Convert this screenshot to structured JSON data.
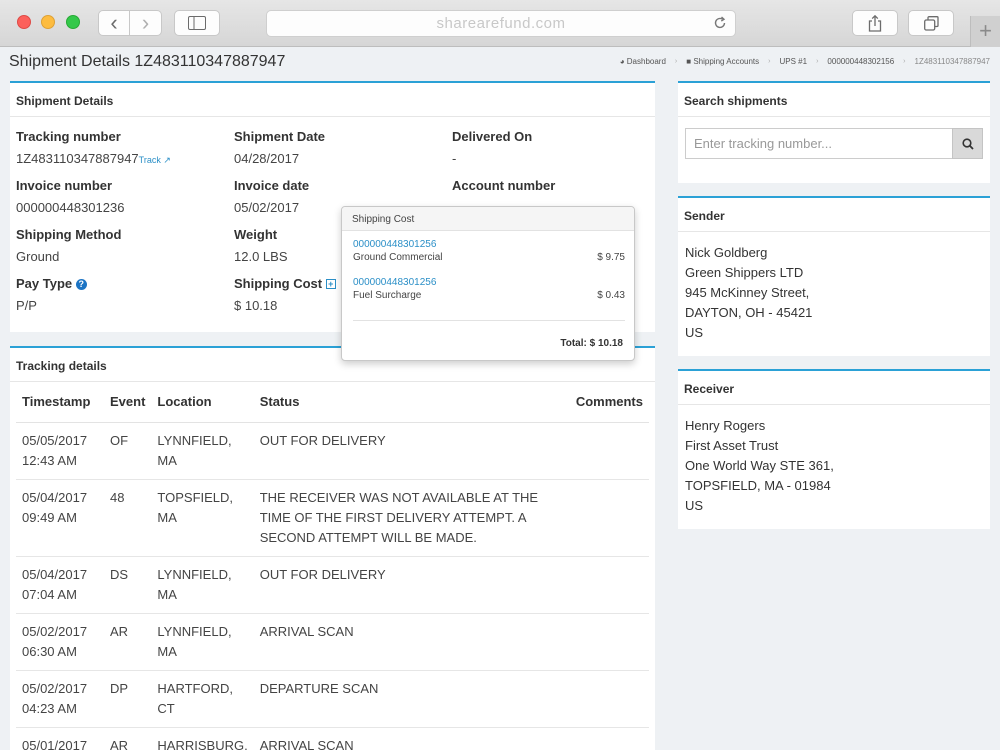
{
  "browser": {
    "url": "sharearefund.com",
    "back_icon": "‹",
    "forward_icon": "›",
    "plus_tab": "+"
  },
  "page": {
    "title": "Shipment Details 1Z483110347887947",
    "breadcrumb": [
      "Dashboard",
      "Shipping Accounts",
      "UPS #1",
      "000000448302156",
      "1Z483110347887947"
    ]
  },
  "shipment": {
    "heading": "Shipment Details",
    "tracking_number_label": "Tracking number",
    "tracking_number": "1Z483110347887947",
    "track_link": "Track",
    "shipment_date_label": "Shipment Date",
    "shipment_date": "04/28/2017",
    "delivered_on_label": "Delivered On",
    "delivered_on": "-",
    "invoice_number_label": "Invoice number",
    "invoice_number": "000000448301236",
    "invoice_date_label": "Invoice date",
    "invoice_date": "05/02/2017",
    "account_number_label": "Account number",
    "shipping_method_label": "Shipping Method",
    "shipping_method": "Ground",
    "weight_label": "Weight",
    "weight": "12.0 LBS",
    "pay_type_label": "Pay Type",
    "pay_type": "P/P",
    "shipping_cost_label": "Shipping Cost",
    "shipping_cost": "$ 10.18"
  },
  "popover": {
    "title": "Shipping Cost",
    "items": [
      {
        "id": "000000448301256",
        "desc": "Ground Commercial",
        "amount": "$ 9.75"
      },
      {
        "id": "000000448301256",
        "desc": "Fuel Surcharge",
        "amount": "$ 0.43"
      }
    ],
    "total": "Total: $ 10.18"
  },
  "tracking": {
    "heading": "Tracking details",
    "columns": [
      "Timestamp",
      "Event",
      "Location",
      "Status",
      "Comments"
    ],
    "rows": [
      {
        "ts1": "05/05/2017",
        "ts2": "12:43 AM",
        "event": "OF",
        "loc1": "LYNNFIELD,",
        "loc2": "MA",
        "status": "OUT FOR DELIVERY"
      },
      {
        "ts1": "05/04/2017",
        "ts2": "09:49 AM",
        "event": "48",
        "loc1": "TOPSFIELD,",
        "loc2": "MA",
        "status": "THE RECEIVER WAS NOT AVAILABLE AT THE TIME OF THE FIRST DELIVERY ATTEMPT. A SECOND ATTEMPT WILL BE MADE."
      },
      {
        "ts1": "05/04/2017",
        "ts2": "07:04 AM",
        "event": "DS",
        "loc1": "LYNNFIELD,",
        "loc2": "MA",
        "status": "OUT FOR DELIVERY"
      },
      {
        "ts1": "05/02/2017",
        "ts2": "06:30 AM",
        "event": "AR",
        "loc1": "LYNNFIELD,",
        "loc2": "MA",
        "status": "ARRIVAL SCAN"
      },
      {
        "ts1": "05/02/2017",
        "ts2": "04:23 AM",
        "event": "DP",
        "loc1": "HARTFORD,",
        "loc2": "CT",
        "status": "DEPARTURE SCAN"
      },
      {
        "ts1": "05/01/2017",
        "ts2": "",
        "event": "AR",
        "loc1": "HARRISBURG,",
        "loc2": "",
        "status": "ARRIVAL SCAN"
      }
    ]
  },
  "search": {
    "heading": "Search shipments",
    "placeholder": "Enter tracking number..."
  },
  "sender": {
    "heading": "Sender",
    "lines": [
      "Nick Goldberg",
      "Green Shippers LTD",
      "945 McKinney Street,",
      "DAYTON, OH - 45421",
      "US"
    ]
  },
  "receiver": {
    "heading": "Receiver",
    "lines": [
      "Henry Rogers",
      "First Asset Trust",
      "One World Way STE 361,",
      "TOPSFIELD, MA - 01984",
      "US"
    ]
  },
  "colors": {
    "accent": "#2ba1d6",
    "link": "#2b8fc7"
  }
}
